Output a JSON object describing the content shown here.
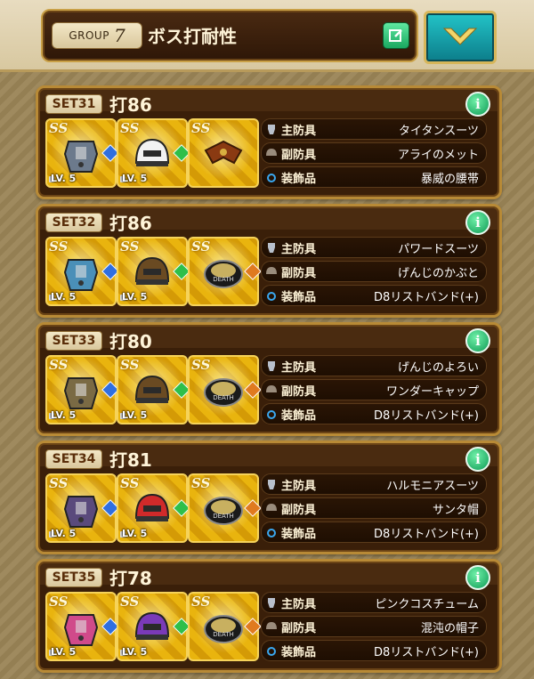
{
  "header": {
    "group_label": "GROUP",
    "group_number": "7",
    "title": "ボス打耐性"
  },
  "equip_types": [
    "主防具",
    "副防具",
    "装飾品"
  ],
  "sets": [
    {
      "label": "SET31",
      "value": "打86",
      "slots": [
        {
          "level": "LV. 5",
          "gem": "#2f6fe0",
          "art": "robot-armor"
        },
        {
          "level": "LV. 5",
          "gem": "#2fbf4a",
          "art": "racing-helmet"
        },
        {
          "level": "",
          "gem": "",
          "art": "dragon-belt"
        }
      ],
      "items": [
        "タイタンスーツ",
        "アライのメット",
        "暴威の腰帯"
      ]
    },
    {
      "label": "SET32",
      "value": "打86",
      "slots": [
        {
          "level": "LV. 5",
          "gem": "#2f6fe0",
          "art": "power-suit"
        },
        {
          "level": "LV. 5",
          "gem": "#2fbf4a",
          "art": "samurai-helmet"
        },
        {
          "level": "",
          "gem": "#e07a1f",
          "art": "wristband"
        }
      ],
      "items": [
        "パワードスーツ",
        "げんじのかぶと",
        "D8リストバンド(+)"
      ]
    },
    {
      "label": "SET33",
      "value": "打80",
      "slots": [
        {
          "level": "LV. 5",
          "gem": "#2f6fe0",
          "art": "samurai-armor"
        },
        {
          "level": "LV. 5",
          "gem": "#2fbf4a",
          "art": "cap"
        },
        {
          "level": "",
          "gem": "#e07a1f",
          "art": "wristband"
        }
      ],
      "items": [
        "げんじのよろい",
        "ワンダーキャップ",
        "D8リストバンド(+)"
      ]
    },
    {
      "label": "SET34",
      "value": "打81",
      "slots": [
        {
          "level": "LV. 5",
          "gem": "#2f6fe0",
          "art": "harmonia-suit"
        },
        {
          "level": "LV. 5",
          "gem": "#2fbf4a",
          "art": "santa-hat"
        },
        {
          "level": "",
          "gem": "#e07a1f",
          "art": "wristband"
        }
      ],
      "items": [
        "ハルモニアスーツ",
        "サンタ帽",
        "D8リストバンド(+)"
      ]
    },
    {
      "label": "SET35",
      "value": "打78",
      "slots": [
        {
          "level": "LV. 5",
          "gem": "#2f6fe0",
          "art": "pink-costume"
        },
        {
          "level": "LV. 5",
          "gem": "#2fbf4a",
          "art": "chaos-hat"
        },
        {
          "level": "",
          "gem": "#e07a1f",
          "art": "wristband"
        }
      ],
      "items": [
        "ピンクコスチューム",
        "混沌の帽子",
        "D8リストバンド(+)"
      ]
    }
  ],
  "colors": {
    "accent_teal": "#1aa0ab",
    "gold": "#c9a046",
    "panel": "#3a1f09"
  }
}
